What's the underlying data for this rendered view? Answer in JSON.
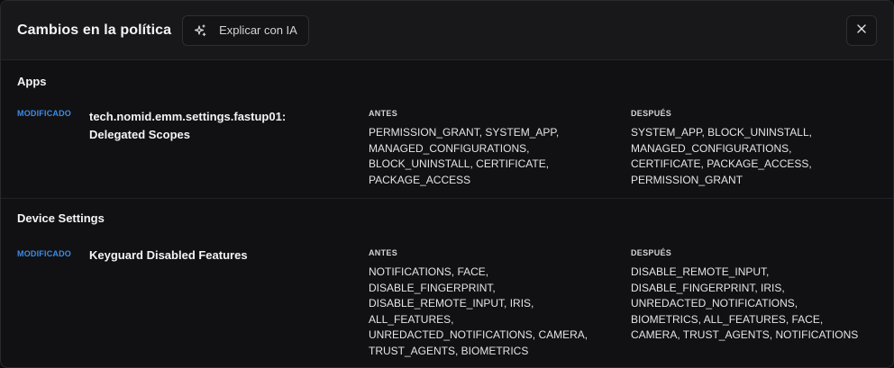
{
  "header": {
    "title": "Cambios en la política",
    "ai_button_label": "Explicar con IA"
  },
  "sections": [
    {
      "title": "Apps",
      "change": {
        "badge": "MODIFICADO",
        "name": "tech.nomid.emm.settings.fastup01: Delegated Scopes",
        "before_label": "ANTES",
        "before_value": "PERMISSION_GRANT, SYSTEM_APP, MANAGED_CONFIGURATIONS, BLOCK_UNINSTALL, CERTIFICATE, PACKAGE_ACCESS",
        "after_label": "DESPUÉS",
        "after_value": "SYSTEM_APP, BLOCK_UNINSTALL, MANAGED_CONFIGURATIONS, CERTIFICATE, PACKAGE_ACCESS, PERMISSION_GRANT"
      }
    },
    {
      "title": "Device Settings",
      "change": {
        "badge": "MODIFICADO",
        "name": "Keyguard Disabled Features",
        "before_label": "ANTES",
        "before_value": "NOTIFICATIONS, FACE, DISABLE_FINGERPRINT, DISABLE_REMOTE_INPUT, IRIS, ALL_FEATURES, UNREDACTED_NOTIFICATIONS, CAMERA, TRUST_AGENTS, BIOMETRICS",
        "after_label": "DESPUÉS",
        "after_value": "DISABLE_REMOTE_INPUT, DISABLE_FINGERPRINT, IRIS, UNREDACTED_NOTIFICATIONS, BIOMETRICS, ALL_FEATURES, FACE, CAMERA, TRUST_AGENTS, NOTIFICATIONS"
      }
    }
  ],
  "colors": {
    "accent": "#3b8bea",
    "background": "#111113",
    "header": "#18181b"
  },
  "icons": {
    "ai": "sparkle-icon",
    "close": "close-icon"
  }
}
